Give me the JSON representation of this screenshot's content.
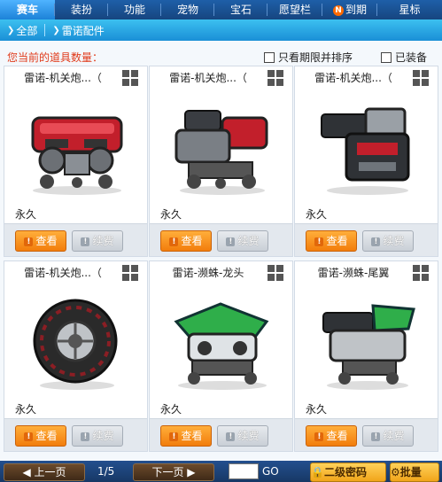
{
  "tabs": [
    {
      "label": "赛车",
      "active": true
    },
    {
      "label": "装扮",
      "active": false
    },
    {
      "label": "功能",
      "active": false
    },
    {
      "label": "宠物",
      "active": false
    },
    {
      "label": "宝石",
      "active": false
    },
    {
      "label": "愿望栏",
      "active": false
    },
    {
      "label": "到期",
      "active": false,
      "badge": "N"
    },
    {
      "label": "星标",
      "active": false
    }
  ],
  "breadcrumb": {
    "all": "全部",
    "current": "雷诺配件"
  },
  "filters": {
    "count_label": "您当前的道具数量：",
    "only_expiring_label": "只看期限并排序",
    "equipped_label": "已装备"
  },
  "items": [
    {
      "name": "雷诺-机关炮...（",
      "duration": "永久",
      "view": "查看",
      "renew": "续费",
      "icon": "engine-red"
    },
    {
      "name": "雷诺-机关炮...（",
      "duration": "永久",
      "view": "查看",
      "renew": "续费",
      "icon": "gun-engine"
    },
    {
      "name": "雷诺-机关炮...（",
      "duration": "永久",
      "view": "查看",
      "renew": "续费",
      "icon": "cannon"
    },
    {
      "name": "雷诺-机关炮...（",
      "duration": "永久",
      "view": "查看",
      "renew": "续费",
      "icon": "wheel"
    },
    {
      "name": "雷诺-濒蛛-龙头",
      "duration": "永久",
      "view": "查看",
      "renew": "续费",
      "icon": "green-engine"
    },
    {
      "name": "雷诺-濒蛛-尾翼",
      "duration": "永久",
      "view": "查看",
      "renew": "续费",
      "icon": "green-tail"
    }
  ],
  "pager": {
    "prev": "上一页",
    "page": "1/5",
    "next": "下一页",
    "go": "GO"
  },
  "actions": {
    "second_pwd": "二级密码",
    "batch": "批量"
  },
  "colors": {
    "accent": "#f27d0c",
    "tab_bar": "#1e5fa8",
    "count_text": "#e03a1a"
  }
}
